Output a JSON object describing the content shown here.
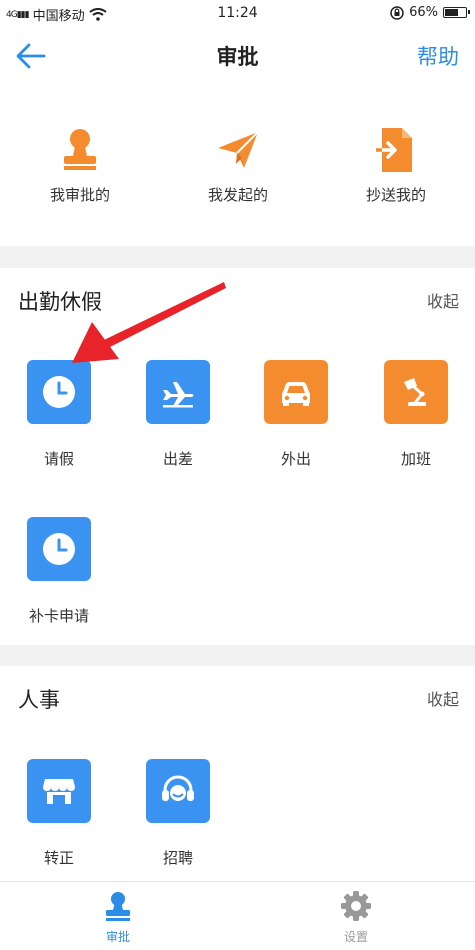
{
  "status_bar": {
    "carrier": "中国移动",
    "time": "11:24",
    "battery": "66%",
    "battery_level": 0.66
  },
  "header": {
    "title": "审批",
    "help": "帮助"
  },
  "quick": [
    {
      "label": "我审批的",
      "icon": "stamp-icon"
    },
    {
      "label": "我发起的",
      "icon": "paper-plane-icon"
    },
    {
      "label": "抄送我的",
      "icon": "document-share-icon"
    }
  ],
  "sections": [
    {
      "title": "出勤休假",
      "collapse": "收起",
      "items": [
        {
          "label": "请假",
          "icon": "clock-icon",
          "color": "#3a93f0"
        },
        {
          "label": "出差",
          "icon": "airplane-icon",
          "color": "#3a93f0"
        },
        {
          "label": "外出",
          "icon": "car-icon",
          "color": "#f48c2f"
        },
        {
          "label": "加班",
          "icon": "desk-lamp-icon",
          "color": "#f48c2f"
        },
        {
          "label": "补卡申请",
          "icon": "clock-icon",
          "color": "#3a93f0"
        }
      ]
    },
    {
      "title": "人事",
      "collapse": "收起",
      "items": [
        {
          "label": "转正",
          "icon": "storefront-icon",
          "color": "#3a93f0"
        },
        {
          "label": "招聘",
          "icon": "headset-icon",
          "color": "#3a93f0"
        }
      ]
    }
  ],
  "bottom_nav": [
    {
      "label": "审批",
      "icon": "stamp-icon",
      "active": true,
      "color": "#2a8de6"
    },
    {
      "label": "设置",
      "icon": "gear-icon",
      "active": false,
      "color": "#999999"
    }
  ],
  "colors": {
    "accent": "#2a8de6",
    "blue_tile": "#3a93f0",
    "orange_tile": "#f48c2f",
    "annotation": "#e8232a"
  }
}
